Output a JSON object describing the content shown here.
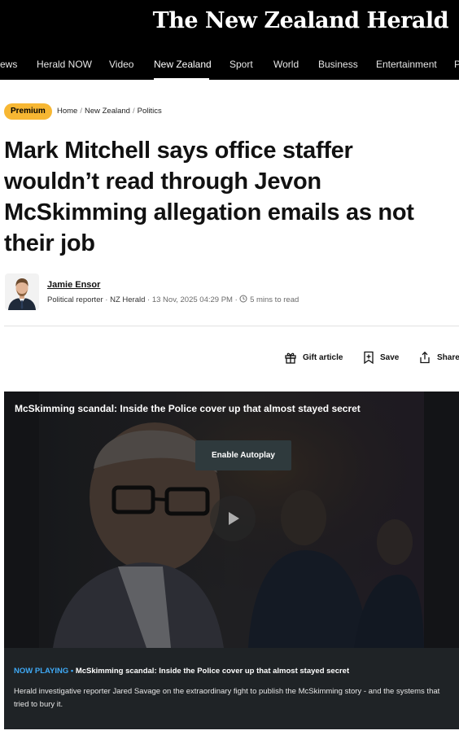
{
  "header": {
    "brand": "The New Zealand Herald"
  },
  "nav": {
    "items": [
      {
        "label": "ews"
      },
      {
        "label": "Herald NOW"
      },
      {
        "label": "Video"
      },
      {
        "label": "New Zealand",
        "active": true
      },
      {
        "label": "Sport"
      },
      {
        "label": "World"
      },
      {
        "label": "Business"
      },
      {
        "label": "Entertainment"
      },
      {
        "label": "P"
      }
    ]
  },
  "article": {
    "badge": "Premium",
    "breadcrumbs": [
      "Home",
      "New Zealand",
      "Politics"
    ],
    "breadcrumb_sep": "/",
    "headline": "Mark Mitchell says office staffer wouldn’t read through Jevon McSkimming allegation emails as not their job",
    "author": {
      "name": "Jamie Ensor",
      "role": "Political reporter",
      "outlet": "NZ Herald",
      "date": "13 Nov, 2025 04:29 PM",
      "read_time": "5 mins to read",
      "dot": "·"
    },
    "actions": {
      "gift_label": "Gift article",
      "save_label": "Save",
      "share_label": "Share"
    }
  },
  "video": {
    "title": "McSkimming scandal: Inside the Police cover up that almost stayed secret",
    "autoplay_label": "Enable Autoplay",
    "now_playing_label": "NOW PLAYING",
    "now_playing_sep": " • ",
    "now_playing_title": "McSkimming scandal: Inside the Police cover up that almost stayed secret",
    "description": "Herald investigative reporter Jared Savage on the extraordinary fight to publish the McSkimming story - and the systems that tried to bury it."
  },
  "colors": {
    "masthead_bg": "#000000",
    "premium_badge": "#f7b733",
    "now_playing_accent": "#3fa9f5",
    "video_bg": "#1b1d20"
  }
}
